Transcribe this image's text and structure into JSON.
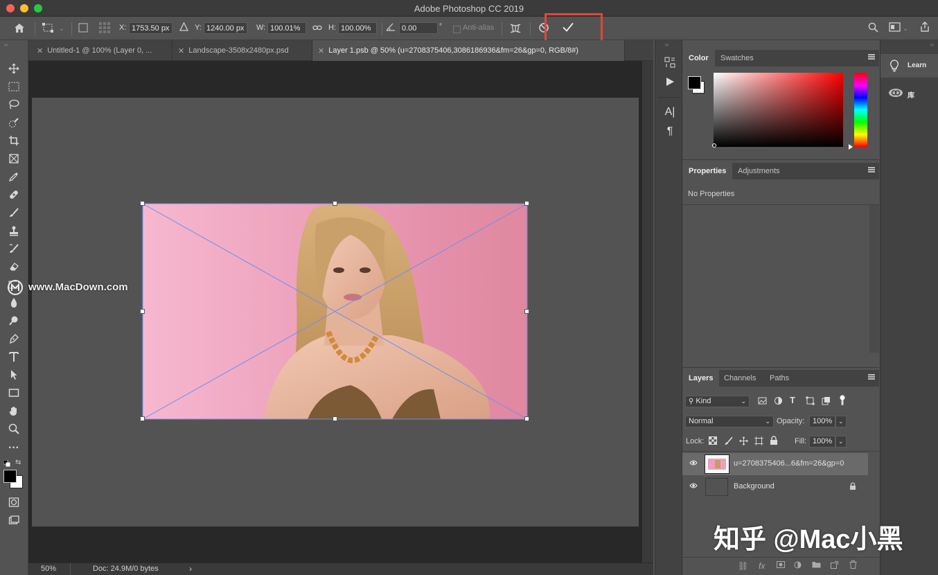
{
  "app": {
    "title": "Adobe Photoshop CC 2019",
    "traffic_lights": {
      "close": "#fe5f57",
      "minimize": "#febc2e",
      "zoom": "#28c840"
    }
  },
  "options_bar": {
    "x_label": "X:",
    "x_value": "1753.50 px",
    "y_label": "Y:",
    "y_value": "1240.00 px",
    "w_label": "W:",
    "w_value": "100.01%",
    "h_label": "H:",
    "h_value": "100.00%",
    "angle_value": "0.00",
    "angle_unit": "°",
    "anti_alias_label": "Anti-alias",
    "icons": [
      "home-icon",
      "reference-point-icon",
      "grid-icon",
      "warp-icon",
      "cancel-transform-icon",
      "commit-checkmark-icon",
      "search-icon",
      "workspace-icon",
      "share-icon"
    ]
  },
  "document_tabs": [
    {
      "label": "Untitled-1 @ 100% (Layer 0, ..."
    },
    {
      "label": "Landscape-3508x2480px.psd"
    },
    {
      "label": "Layer 1.psb @ 50% (u=2708375406,3086186936&fm=26&gp=0, RGB/8#)"
    }
  ],
  "status": {
    "zoom": "50%",
    "doc_info": "Doc: 24.9M/0 bytes",
    "arrow": "›"
  },
  "watermarks": {
    "left": "www.MacDown.com",
    "right": "知乎 @Mac小黑"
  },
  "color_panel": {
    "tabs": [
      "Color",
      "Swatches"
    ],
    "foreground": "#000000",
    "background": "#ffffff",
    "hue": "#ff0000"
  },
  "properties_panel": {
    "tabs": [
      "Properties",
      "Adjustments"
    ],
    "message": "No Properties"
  },
  "layers_panel": {
    "tabs": [
      "Layers",
      "Channels",
      "Paths"
    ],
    "filter_label": "Kind",
    "blend_mode": "Normal",
    "opacity_label": "Opacity:",
    "opacity_value": "100%",
    "lock_label": "Lock:",
    "fill_label": "Fill:",
    "fill_value": "100%",
    "layers": [
      {
        "name": "u=2708375406...6&fm=26&gp=0",
        "visible": true,
        "selected": true
      },
      {
        "name": "Background",
        "visible": true,
        "selected": false
      }
    ]
  },
  "learn_panel": {
    "items": [
      "Learn",
      "库"
    ]
  }
}
